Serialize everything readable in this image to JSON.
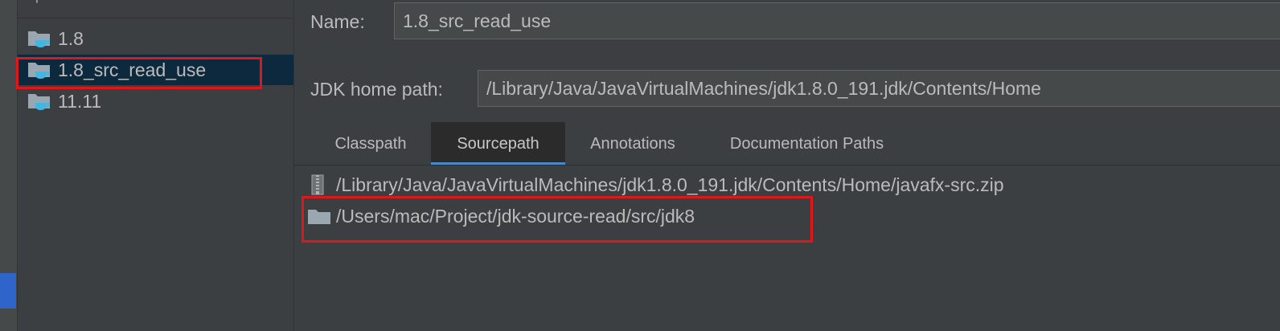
{
  "toolbar": {
    "add_icon": "plus-icon",
    "remove_icon": "minus-icon",
    "add_label": "+",
    "remove_label": "−"
  },
  "sdk_list": [
    {
      "label": "1.8",
      "icon": "jdk-folder-icon"
    },
    {
      "label": "1.8_src_read_use",
      "icon": "jdk-folder-icon"
    },
    {
      "label": "11.11",
      "icon": "jdk-folder-icon"
    }
  ],
  "form": {
    "name_label": "Name:",
    "name_value": "1.8_src_read_use",
    "home_label": "JDK home path:",
    "home_value": "/Library/Java/JavaVirtualMachines/jdk1.8.0_191.jdk/Contents/Home"
  },
  "tabs": [
    {
      "label": "Classpath"
    },
    {
      "label": "Sourcepath"
    },
    {
      "label": "Annotations"
    },
    {
      "label": "Documentation Paths"
    }
  ],
  "sourcepath": [
    {
      "path": "/Library/Java/JavaVirtualMachines/jdk1.8.0_191.jdk/Contents/Home/javafx-src.zip",
      "icon": "archive-icon"
    },
    {
      "path": "/Users/mac/Project/jdk-source-read/src/jdk8",
      "icon": "folder-icon"
    }
  ],
  "colors": {
    "background": "#3c3f41",
    "selection": "#0d293e",
    "highlight_box": "#e0161b",
    "tab_underline": "#4a88c7",
    "folder": "#9aa7b0",
    "java_cup": "#40b6e0"
  }
}
